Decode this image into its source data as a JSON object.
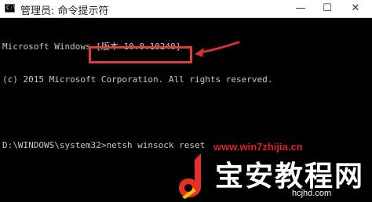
{
  "window": {
    "title": "管理员: 命令提示符",
    "icon_name": "cmd-icon",
    "icon_glyph": "C:\\",
    "minimize_glyph": "—",
    "maximize_glyph": "☐",
    "close_glyph": "✕"
  },
  "console": {
    "lines": [
      "Microsoft Windows [版本 10.0.10240]",
      "(c) 2015 Microsoft Corporation. All rights reserved.",
      "",
      "D:\\WINDOWS\\system32>netsh winsock reset"
    ]
  },
  "annotation": {
    "highlight_color": "#e23b3b",
    "arrow_color": "#d93030"
  },
  "watermark": {
    "url": "www.win7zhijia.cn",
    "brand_name": "宝安教程网",
    "brand_domain": "hcjhd.com",
    "logo_color": "#e8302a"
  }
}
